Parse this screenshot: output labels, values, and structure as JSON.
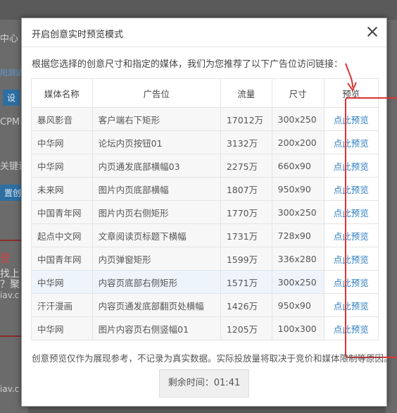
{
  "background": {
    "fragments": [
      "中心",
      "阳测试",
      "设",
      "CPM",
      "关键词",
      "置创",
      "登",
      "找上",
      "？聚",
      "iav.c",
      "iav.c"
    ]
  },
  "modal": {
    "title": "开启创意实时预览模式",
    "close_icon": "close-icon",
    "intro": "根据您选择的创意尺寸和指定的媒体，我们为您推荐了以下广告位访问链接：",
    "columns": [
      "媒体名称",
      "广告位",
      "流量",
      "尺寸",
      "预览"
    ],
    "rows": [
      {
        "media": "暴风影音",
        "slot": "客户端右下矩形",
        "traffic": "17012万",
        "size": "300x250",
        "preview": "点此预览"
      },
      {
        "media": "中华网",
        "slot": "论坛内页按钮01",
        "traffic": "3132万",
        "size": "200x200",
        "preview": "点此预览"
      },
      {
        "media": "中华网",
        "slot": "内页通发底部横幅03",
        "traffic": "2275万",
        "size": "660x90",
        "preview": "点此预览"
      },
      {
        "media": "未来网",
        "slot": "图片内页底部横幅",
        "traffic": "1807万",
        "size": "950x90",
        "preview": "点此预览"
      },
      {
        "media": "中国青年网",
        "slot": "图片内页右侧矩形",
        "traffic": "1770万",
        "size": "300x250",
        "preview": "点此预览"
      },
      {
        "media": "起点中文网",
        "slot": "文章阅读页标题下横幅",
        "traffic": "1731万",
        "size": "728x90",
        "preview": "点此预览"
      },
      {
        "media": "中国青年网",
        "slot": "内页弹窗矩形",
        "traffic": "1599万",
        "size": "336x280",
        "preview": "点此预览"
      },
      {
        "media": "中华网",
        "slot": "内容页底部右侧矩形",
        "traffic": "1571万",
        "size": "300x250",
        "preview": "点此预览"
      },
      {
        "media": "汗汗漫画",
        "slot": "内容页通发底部翻页处横幅",
        "traffic": "1426万",
        "size": "950x90",
        "preview": "点此预览"
      },
      {
        "media": "中华网",
        "slot": "图片内容页右侧竖幅01",
        "traffic": "1205万",
        "size": "100x300",
        "preview": "点此预览"
      }
    ],
    "footnote": "创意预览仅作为展现参考，不记录为真实数据。实际投放量将取决于竞价和媒体限制等原因。",
    "timer": "剩余时间：01:41"
  },
  "colors": {
    "link": "#2f7ec0",
    "highlight": "#dd3333"
  }
}
